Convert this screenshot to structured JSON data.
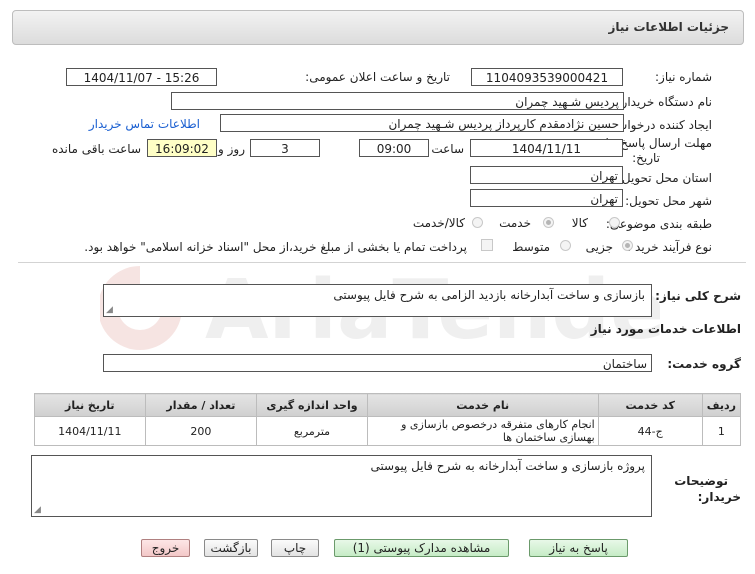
{
  "header": {
    "title": "جزئیات اطلاعات نیاز"
  },
  "form": {
    "need_number_label": "شماره نیاز:",
    "need_number": "1104093539000421",
    "announce_label": "تاریخ و ساعت اعلان عمومی:",
    "announce_value": "1404/11/07 - 15:26",
    "buyer_org_label": "نام دستگاه خریدار:",
    "buyer_org": "پردیس شـهید چمران",
    "creator_label": "ایجاد کننده درخواست:",
    "creator": "حسین نژادمقدم کارپرداز پردیس شـهید چمران",
    "contact_link": "اطلاعات تماس خریدار",
    "deadline_label_line1": "مهلت ارسال پاسخ: تا",
    "deadline_label_line2": "تاریخ:",
    "deadline_date": "1404/11/11",
    "time_label": "ساعت",
    "deadline_time": "09:00",
    "days_value": "3",
    "days_label": "روز و",
    "remaining_time": "16:09:02",
    "remaining_label": "ساعت باقی مانده",
    "province_label": "استان محل تحویل:",
    "province": "تهران",
    "city_label": "شهر محل تحویل:",
    "city": "تهران",
    "category_label": "طبقه بندی موضوعی:",
    "category_options": [
      "کالا",
      "خدمت",
      "کالا/خدمت"
    ],
    "category_selected": "خدمت",
    "process_label": "نوع فرآیند خرید :",
    "process_options": [
      "جزیی",
      "متوسط"
    ],
    "process_selected": "جزیی",
    "payment_note": "پرداخت تمام یا بخشی از مبلغ خرید،از محل \"اسناد خزانه اسلامی\" خواهد بود."
  },
  "summary": {
    "label": "شرح کلی نیاز:",
    "text": "بازسازی و ساخت آبدارخانه  بازدید الزامی به شرح فایل پیوستی"
  },
  "services_section": {
    "title": "اطلاعات خدمات مورد نیاز",
    "group_label": "گروه خدمت:",
    "group_value": "ساختمان"
  },
  "table": {
    "headers": [
      "ردیف",
      "کد خدمت",
      "نام خدمت",
      "واحد اندازه گیری",
      "تعداد / مقدار",
      "تاریخ نیاز"
    ],
    "rows": [
      [
        "1",
        "ج-44",
        "انجام کارهای متفرقه درخصوص بازسازی و بهسازی ساختمان ها",
        "مترمربع",
        "200",
        "1404/11/11"
      ]
    ]
  },
  "notes": {
    "label_line1": "توضیحات",
    "label_line2": "خریدار:",
    "text": "پروژه بازسازی و ساخت آبدارخانه به شرح فایل پیوستی"
  },
  "buttons": {
    "reply": "پاسخ به نیاز",
    "attachments": "مشاهده مدارک پیوستی (1)",
    "print": "چاپ",
    "back": "بازگشت",
    "exit": "خروج"
  },
  "watermark": {
    "text": "AriaTender.net"
  },
  "colors": {
    "link": "#1a5fd1",
    "highlight": "#ffffc6",
    "watermark": "#c0392b"
  }
}
